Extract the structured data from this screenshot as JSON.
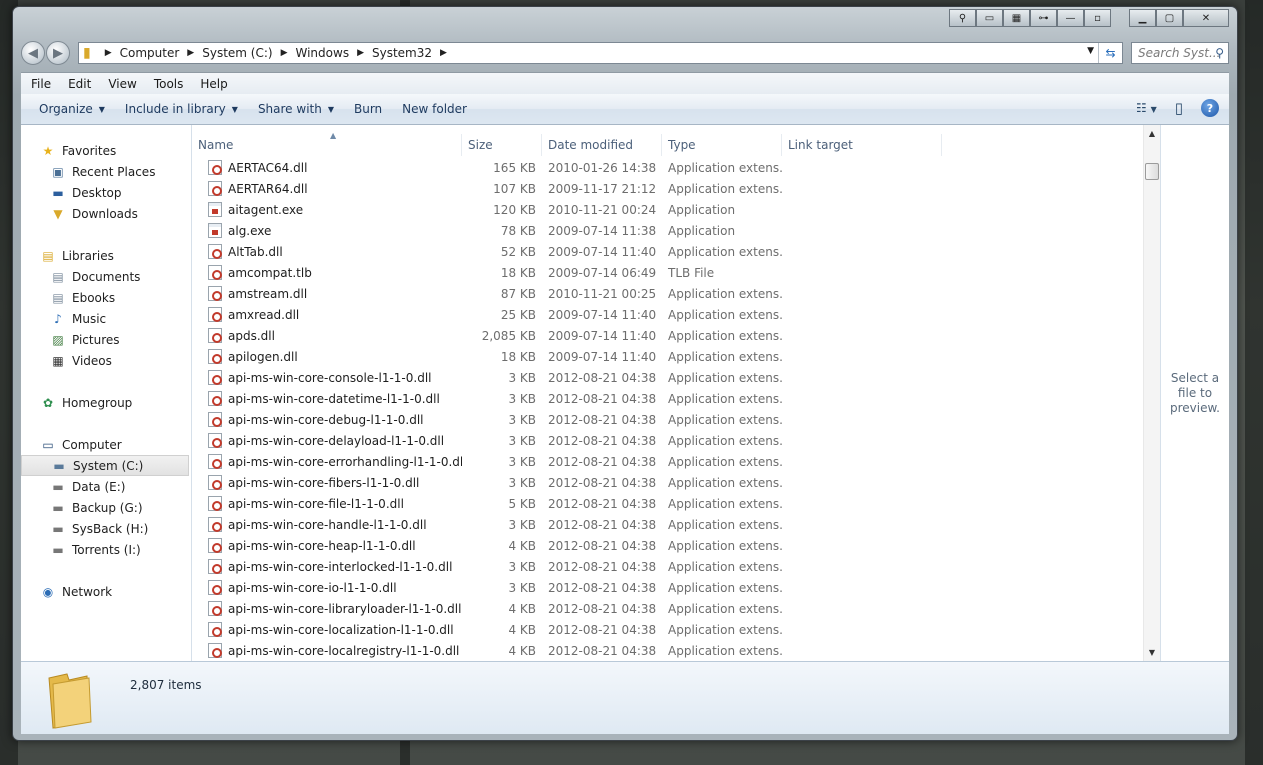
{
  "address": {
    "crumbs": [
      "Computer",
      "System (C:)",
      "Windows",
      "System32"
    ],
    "search_placeholder": "Search Syst..."
  },
  "menu": [
    "File",
    "Edit",
    "View",
    "Tools",
    "Help"
  ],
  "commands": {
    "organize": "Organize",
    "include": "Include in library",
    "share": "Share with",
    "burn": "Burn",
    "new_folder": "New folder"
  },
  "nav": {
    "favorites": "Favorites",
    "recent": "Recent Places",
    "desktop": "Desktop",
    "downloads": "Downloads",
    "libraries": "Libraries",
    "documents": "Documents",
    "ebooks": "Ebooks",
    "music": "Music",
    "pictures": "Pictures",
    "videos": "Videos",
    "homegroup": "Homegroup",
    "computer": "Computer",
    "system": "System (C:)",
    "data": "Data (E:)",
    "backup": "Backup (G:)",
    "sysback": "SysBack (H:)",
    "torrents": "Torrents (I:)",
    "network": "Network"
  },
  "columns": {
    "name": "Name",
    "size": "Size",
    "date": "Date modified",
    "type": "Type",
    "link": "Link target"
  },
  "files": [
    {
      "name": "AERTAC64.dll",
      "size": "165 KB",
      "date": "2010-01-26 14:38",
      "type": "Application extens...",
      "kind": "dll"
    },
    {
      "name": "AERTAR64.dll",
      "size": "107 KB",
      "date": "2009-11-17 21:12",
      "type": "Application extens...",
      "kind": "dll"
    },
    {
      "name": "aitagent.exe",
      "size": "120 KB",
      "date": "2010-11-21 00:24",
      "type": "Application",
      "kind": "exe"
    },
    {
      "name": "alg.exe",
      "size": "78 KB",
      "date": "2009-07-14 11:38",
      "type": "Application",
      "kind": "exe"
    },
    {
      "name": "AltTab.dll",
      "size": "52 KB",
      "date": "2009-07-14 11:40",
      "type": "Application extens...",
      "kind": "dll"
    },
    {
      "name": "amcompat.tlb",
      "size": "18 KB",
      "date": "2009-07-14 06:49",
      "type": "TLB File",
      "kind": "tlb"
    },
    {
      "name": "amstream.dll",
      "size": "87 KB",
      "date": "2010-11-21 00:25",
      "type": "Application extens...",
      "kind": "dll"
    },
    {
      "name": "amxread.dll",
      "size": "25 KB",
      "date": "2009-07-14 11:40",
      "type": "Application extens...",
      "kind": "dll"
    },
    {
      "name": "apds.dll",
      "size": "2,085 KB",
      "date": "2009-07-14 11:40",
      "type": "Application extens...",
      "kind": "dll"
    },
    {
      "name": "apilogen.dll",
      "size": "18 KB",
      "date": "2009-07-14 11:40",
      "type": "Application extens...",
      "kind": "dll"
    },
    {
      "name": "api-ms-win-core-console-l1-1-0.dll",
      "size": "3 KB",
      "date": "2012-08-21 04:38",
      "type": "Application extens...",
      "kind": "dll"
    },
    {
      "name": "api-ms-win-core-datetime-l1-1-0.dll",
      "size": "3 KB",
      "date": "2012-08-21 04:38",
      "type": "Application extens...",
      "kind": "dll"
    },
    {
      "name": "api-ms-win-core-debug-l1-1-0.dll",
      "size": "3 KB",
      "date": "2012-08-21 04:38",
      "type": "Application extens...",
      "kind": "dll"
    },
    {
      "name": "api-ms-win-core-delayload-l1-1-0.dll",
      "size": "3 KB",
      "date": "2012-08-21 04:38",
      "type": "Application extens...",
      "kind": "dll"
    },
    {
      "name": "api-ms-win-core-errorhandling-l1-1-0.dll",
      "size": "3 KB",
      "date": "2012-08-21 04:38",
      "type": "Application extens...",
      "kind": "dll"
    },
    {
      "name": "api-ms-win-core-fibers-l1-1-0.dll",
      "size": "3 KB",
      "date": "2012-08-21 04:38",
      "type": "Application extens...",
      "kind": "dll"
    },
    {
      "name": "api-ms-win-core-file-l1-1-0.dll",
      "size": "5 KB",
      "date": "2012-08-21 04:38",
      "type": "Application extens...",
      "kind": "dll"
    },
    {
      "name": "api-ms-win-core-handle-l1-1-0.dll",
      "size": "3 KB",
      "date": "2012-08-21 04:38",
      "type": "Application extens...",
      "kind": "dll"
    },
    {
      "name": "api-ms-win-core-heap-l1-1-0.dll",
      "size": "4 KB",
      "date": "2012-08-21 04:38",
      "type": "Application extens...",
      "kind": "dll"
    },
    {
      "name": "api-ms-win-core-interlocked-l1-1-0.dll",
      "size": "3 KB",
      "date": "2012-08-21 04:38",
      "type": "Application extens...",
      "kind": "dll"
    },
    {
      "name": "api-ms-win-core-io-l1-1-0.dll",
      "size": "3 KB",
      "date": "2012-08-21 04:38",
      "type": "Application extens...",
      "kind": "dll"
    },
    {
      "name": "api-ms-win-core-libraryloader-l1-1-0.dll",
      "size": "4 KB",
      "date": "2012-08-21 04:38",
      "type": "Application extens...",
      "kind": "dll"
    },
    {
      "name": "api-ms-win-core-localization-l1-1-0.dll",
      "size": "4 KB",
      "date": "2012-08-21 04:38",
      "type": "Application extens...",
      "kind": "dll"
    },
    {
      "name": "api-ms-win-core-localregistry-l1-1-0.dll",
      "size": "4 KB",
      "date": "2012-08-21 04:38",
      "type": "Application extens...",
      "kind": "dll"
    }
  ],
  "preview_text": "Select a file to preview.",
  "status": {
    "count": "2,807 items"
  }
}
